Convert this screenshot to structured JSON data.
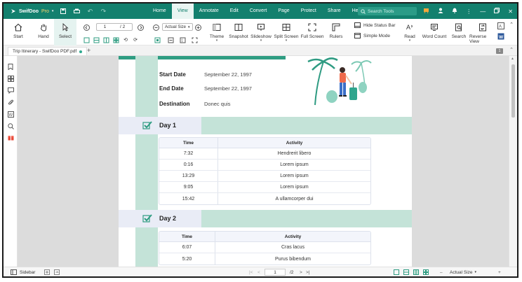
{
  "app": {
    "name": "SwifDoo",
    "edition": "Pro",
    "search_placeholder": "Search Tools"
  },
  "menu": {
    "items": [
      "Home",
      "View",
      "Annotate",
      "Edit",
      "Convert",
      "Page",
      "Protect",
      "Share",
      "Help"
    ],
    "active": "View"
  },
  "ribbon": {
    "start": "Start",
    "hand": "Hand",
    "select": "Select",
    "page_current": "1",
    "page_total": "/ 2",
    "zoom": "Actual Size",
    "theme": "Theme",
    "snapshot": "Snapshot",
    "slideshow": "Slideshow",
    "split_screen": "Split Screen",
    "full_screen": "Full Screen",
    "rulers": "Rulers",
    "hide_status_bar": "Hide Status Bar",
    "simple_mode": "Simple Mode",
    "read": "Read",
    "word_count": "Word Count",
    "search": "Search",
    "reverse_view": "Reverse View"
  },
  "tab": {
    "title": "Trip Itinerary - SwifDoo PDF.pdf",
    "page_badge": "1"
  },
  "document": {
    "info": [
      {
        "label": "Start Date",
        "value": "September 22, 1997"
      },
      {
        "label": "End Date",
        "value": "September 22, 1997"
      },
      {
        "label": "Destination",
        "value": "Donec quis"
      }
    ],
    "days": [
      {
        "title": "Day 1",
        "headers": [
          "Time",
          "Activity"
        ],
        "rows": [
          [
            "7:32",
            "Hendrerit libero"
          ],
          [
            "0:16",
            "Lorem ipsum"
          ],
          [
            "13:29",
            "Lorem ipsum"
          ],
          [
            "9:05",
            "Lorem ipsum"
          ],
          [
            "15:42",
            "A ullamcorper dui"
          ]
        ]
      },
      {
        "title": "Day 2",
        "headers": [
          "Time",
          "Activity"
        ],
        "rows": [
          [
            "6:07",
            "Cras lacus"
          ],
          [
            "5:20",
            "Purus bibendum"
          ]
        ]
      }
    ]
  },
  "status": {
    "sidebar": "Sidebar",
    "page_current": "1",
    "page_total": "/2",
    "zoom": "Actual Size"
  },
  "colors": {
    "brand": "#13806e",
    "mint": "#c4e3d8",
    "accent": "#2f9d82"
  }
}
